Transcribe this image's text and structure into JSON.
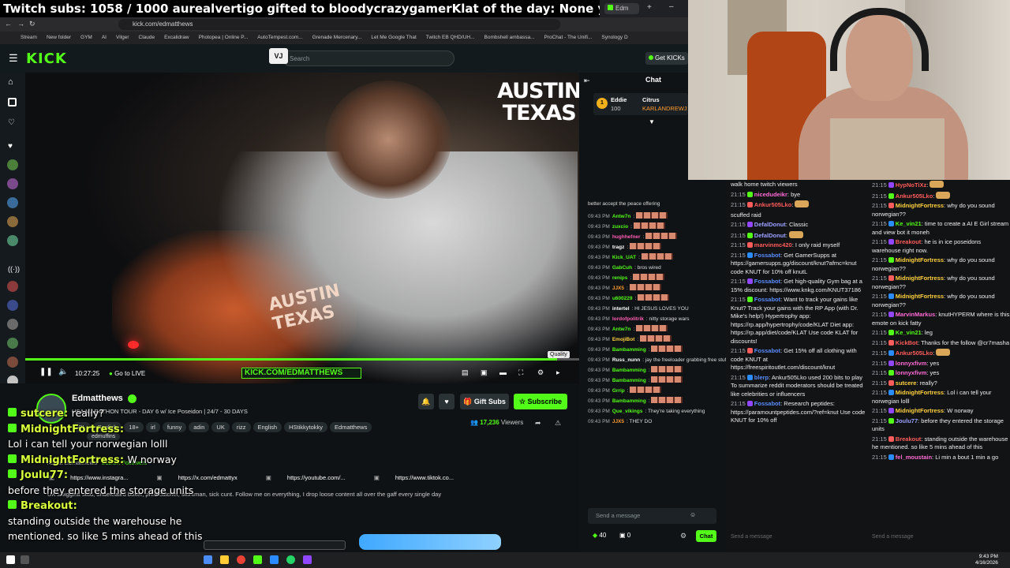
{
  "overlay": {
    "text": "Twitch subs: 1058 / 1000    aurealvertigo gifted to bloodycrazygamerKlat of the day: None yet"
  },
  "browser": {
    "tab_title": "Edm",
    "url": "kick.com/edmatthews",
    "bookmarks": [
      "Stream",
      "New folder",
      "GYM",
      "AI",
      "Vilger",
      "Claude",
      "Excalidraw",
      "Photopea | Online P...",
      "AutoTempest.com...",
      "Grenade Mercenary...",
      "Let Me Google That",
      "Twitch EB QHD/UH...",
      "Bombshell ambassa...",
      "ProChat - The Unifi...",
      "Synology D"
    ]
  },
  "kick": {
    "logo": "KICK",
    "search_placeholder": "Search",
    "search_shortcut": "VJ",
    "get_kick": "Get KICKs"
  },
  "video": {
    "overlay_title": "AUSTIN\nTEXAS",
    "shirt_text": "AUSTIN TEXAS",
    "time": "10:27:25",
    "go_live": "Go to LIVE",
    "banner": "KICK.COM/EDMATTHEWS",
    "quality_tooltip": "Quality",
    "progress": 0.96
  },
  "channel": {
    "name": "Edmatthews",
    "title": "USA MARATHON TOUR - DAY 6 w/ Ice Poseidon | 24/7 - 30 DAYS",
    "tags": [
      "IRL",
      "English",
      "18+",
      "irl",
      "funny",
      "adin",
      "UK",
      "rizz",
      "English",
      "HStikkytokky",
      "Edmatthews"
    ],
    "viewers": "17,236",
    "viewers_label": "Viewers",
    "gift_subs": "Gift Subs",
    "subscribe": "Subscribe",
    "about_title": "About Edmatthews",
    "followers": "211.5K Followers",
    "socials": [
      "https://www.instagra...",
      "https://x.com/edmattyx",
      "https://youtube.com/...",
      "https://www.tiktok.co..."
    ],
    "description": "UK's biggest stud, undefeated boxer, pred catcher, stuntman, sick cunt. Follow me on everything, I drop loose content all over the gaff every single day",
    "secondary_name": "edmuffins"
  },
  "overlay_chat": [
    {
      "name": "sutcere",
      "msg": "really?"
    },
    {
      "name": "MidnightFortress",
      "msg": ""
    },
    {
      "name": "",
      "msg": "Lol i can tell your norwegian lolll"
    },
    {
      "name": "MidnightFortress",
      "msg": "W  norway"
    },
    {
      "name": "Joulu77",
      "msg": ""
    },
    {
      "name": "",
      "msg": "before they entered the storage units"
    },
    {
      "name": "Breakout",
      "msg": ""
    },
    {
      "name": "",
      "msg": "standing outside the warehouse he"
    },
    {
      "name": "",
      "msg": "mentioned. so like 5 mins ahead of this"
    }
  ],
  "kick_chat": {
    "title": "Chat",
    "pinned": {
      "user1": "Eddie",
      "count": "100",
      "user2": "Citrus",
      "user3": "KARLANDREWJ"
    },
    "preface": "better accept the peace offering",
    "messages": [
      {
        "time": "09:43 PM",
        "user": "Antw7n",
        "color": "#53fc18",
        "text": ""
      },
      {
        "time": "09:43 PM",
        "user": "zuxcio",
        "color": "#53fc18",
        "text": ""
      },
      {
        "time": "09:43 PM",
        "user": "hughhefner",
        "color": "#ff5cb4",
        "text": ""
      },
      {
        "time": "09:43 PM",
        "user": "tragz",
        "color": "#fff",
        "text": ""
      },
      {
        "time": "09:43 PM",
        "user": "Kick_UAT",
        "color": "#53fc18",
        "text": ""
      },
      {
        "time": "09:43 PM",
        "user": "GabCuh",
        "color": "#53fc18",
        "text": "bros wired"
      },
      {
        "time": "09:43 PM",
        "user": "renips",
        "color": "#53fc18",
        "text": ""
      },
      {
        "time": "09:43 PM",
        "user": "JJX5",
        "color": "#ff9b2f",
        "text": ""
      },
      {
        "time": "09:43 PM",
        "user": "u600229",
        "color": "#53fc18",
        "text": ""
      },
      {
        "time": "09:43 PM",
        "user": "intertel",
        "color": "#fff",
        "text": "HI JESUS LOVES YOU"
      },
      {
        "time": "09:43 PM",
        "user": "lordofpolitrik",
        "color": "#ff5cb4",
        "text": "nitty storage wars"
      },
      {
        "time": "09:43 PM",
        "user": "Antw7n",
        "color": "#53fc18",
        "text": ""
      },
      {
        "time": "09:43 PM",
        "user": "EmojiBot",
        "color": "#ffd23f",
        "text": ""
      },
      {
        "time": "09:43 PM",
        "user": "Bambamming",
        "color": "#53fc18",
        "text": ""
      },
      {
        "time": "09:43 PM",
        "user": "Russ_nunn",
        "color": "#fff",
        "text": "jay the freeloader grabbing free stuff"
      },
      {
        "time": "09:43 PM",
        "user": "Bambamming",
        "color": "#53fc18",
        "text": ""
      },
      {
        "time": "09:43 PM",
        "user": "Bambamming",
        "color": "#53fc18",
        "text": ""
      },
      {
        "time": "09:43 PM",
        "user": "Grrip",
        "color": "#53fc18",
        "text": ""
      },
      {
        "time": "09:43 PM",
        "user": "Bambamming",
        "color": "#53fc18",
        "text": ""
      },
      {
        "time": "09:43 PM",
        "user": "Que_vikings",
        "color": "#53fc18",
        "text": "They're taking everything"
      },
      {
        "time": "09:43 PM",
        "user": "JJX5",
        "color": "#ff9b2f",
        "text": "THEY DO"
      }
    ],
    "input_placeholder": "Send a message",
    "points": "40",
    "gifts": "0",
    "chat_button": "Chat"
  },
  "twitch_chat": {
    "left": [
      {
        "time": "",
        "user": "",
        "color": "#efeff1",
        "text": "walk home twitch viewers"
      },
      {
        "time": "21:15",
        "user": "nicedudeikr",
        "color": "#ff6bd6",
        "text": "bye"
      },
      {
        "time": "21:15",
        "user": "Ankur505Lko",
        "color": "#ff5c5c",
        "text": ""
      },
      {
        "time": "",
        "user": "",
        "color": "#efeff1",
        "text": "scuffed raid"
      },
      {
        "time": "21:15",
        "user": "DefalDonut",
        "color": "#9aa0ff",
        "text": "Classic"
      },
      {
        "time": "21:15",
        "user": "DefalDonut",
        "color": "#9aa0ff",
        "text": ""
      },
      {
        "time": "21:15",
        "user": "marvinmc420",
        "color": "#ff5c5c",
        "text": "I only raid myself"
      },
      {
        "time": "21:15",
        "user": "Fossabot",
        "color": "#5a8dfe",
        "text": "Get GamerSupps at https://gamersupps.gg/discount/knut?afmc=knut code KNUT for 10% off knutL"
      },
      {
        "time": "21:15",
        "user": "Fossabot",
        "color": "#5a8dfe",
        "text": "Get high-quality Gym bag at a 15% discount: https://www.knkg.com/KNUT37186"
      },
      {
        "time": "21:15",
        "user": "Fossabot",
        "color": "#5a8dfe",
        "text": "Want to track your gains like Knut? Track your gains with the RP App (with Dr. Mike's help!) Hypertrophy app: https://rp.app/hypertrophy/code/KLAT Diet app: https://rp.app/diet/code/KLAT Use code KLAT for discounts!"
      },
      {
        "time": "21:15",
        "user": "Fossabot",
        "color": "#5a8dfe",
        "text": "Get 15% off all clothing with code KNUT at https://freespiritoutlet.com/discount/knut"
      },
      {
        "time": "21:15",
        "user": "blerp",
        "color": "#5a8dfe",
        "text": "Ankur505Lko used 200 bits to play To summarize reddit moderators should be treated like celebrities or influencers"
      },
      {
        "time": "21:15",
        "user": "Fossabot",
        "color": "#5a8dfe",
        "text": "Research peptides: https://paramountpeptides.com/?ref=knut Use code KNUT for 10% off"
      }
    ],
    "right": [
      {
        "time": "21:15",
        "user": "HypNoTiXz",
        "color": "#ff5c5c",
        "text": ""
      },
      {
        "time": "21:15",
        "user": "Ankur505Lko",
        "color": "#ff5c5c",
        "text": ""
      },
      {
        "time": "21:15",
        "user": "MidnightFortress",
        "color": "#ffd23f",
        "text": "why do you sound norwegian??"
      },
      {
        "time": "21:15",
        "user": "Ke_vin21",
        "color": "#53fc18",
        "text": "time to create a AI E Girl stream and view bot it moneh"
      },
      {
        "time": "21:15",
        "user": "Breakout",
        "color": "#ff5c5c",
        "text": "he is in ice poseidons warehouse right now."
      },
      {
        "time": "21:15",
        "user": "MidnightFortress",
        "color": "#ffd23f",
        "text": "why do you sound norwegian??"
      },
      {
        "time": "21:15",
        "user": "MidnightFortress",
        "color": "#ffd23f",
        "text": "why do you sound norwegian??"
      },
      {
        "time": "21:15",
        "user": "MidnightFortress",
        "color": "#ffd23f",
        "text": "why do you sound norwegian??"
      },
      {
        "time": "21:15",
        "user": "MarvinMarkus",
        "color": "#ff6bd6",
        "text": "knutHYPERM where is this emote on kick fatty"
      },
      {
        "time": "21:15",
        "user": "Ke_vin21",
        "color": "#53fc18",
        "text": "leg"
      },
      {
        "time": "21:15",
        "user": "KickBot",
        "color": "#ff5c5c",
        "text": "Thanks for the follow @cr7masha"
      },
      {
        "time": "21:15",
        "user": "Ankur505Lko",
        "color": "#ff5c5c",
        "text": ""
      },
      {
        "time": "21:15",
        "user": "lonnyxfivm",
        "color": "#ff6bd6",
        "text": "yes"
      },
      {
        "time": "21:15",
        "user": "lonnyxfivm",
        "color": "#ff6bd6",
        "text": "yes"
      },
      {
        "time": "21:15",
        "user": "sutcere",
        "color": "#ffd23f",
        "text": "really?"
      },
      {
        "time": "21:15",
        "user": "MidnightFortress",
        "color": "#ffd23f",
        "text": "Lol i can tell your norwegian lolll"
      },
      {
        "time": "21:15",
        "user": "MidnightFortress",
        "color": "#ffd23f",
        "text": "W norway"
      },
      {
        "time": "21:15",
        "user": "Joulu77",
        "color": "#9aa0ff",
        "text": "before they entered the storage units"
      },
      {
        "time": "21:15",
        "user": "Breakout",
        "color": "#ff5c5c",
        "text": "standing outside the warehouse he mentioned. so like 5 mins ahead of this"
      },
      {
        "time": "21:15",
        "user": "fel_moustain",
        "color": "#ff6bd6",
        "text": "Li min a bout 1 min a go"
      }
    ],
    "input_placeholder": "Send a message"
  },
  "taskbar": {
    "time": "9:43 PM",
    "date": "4/16/2026"
  }
}
